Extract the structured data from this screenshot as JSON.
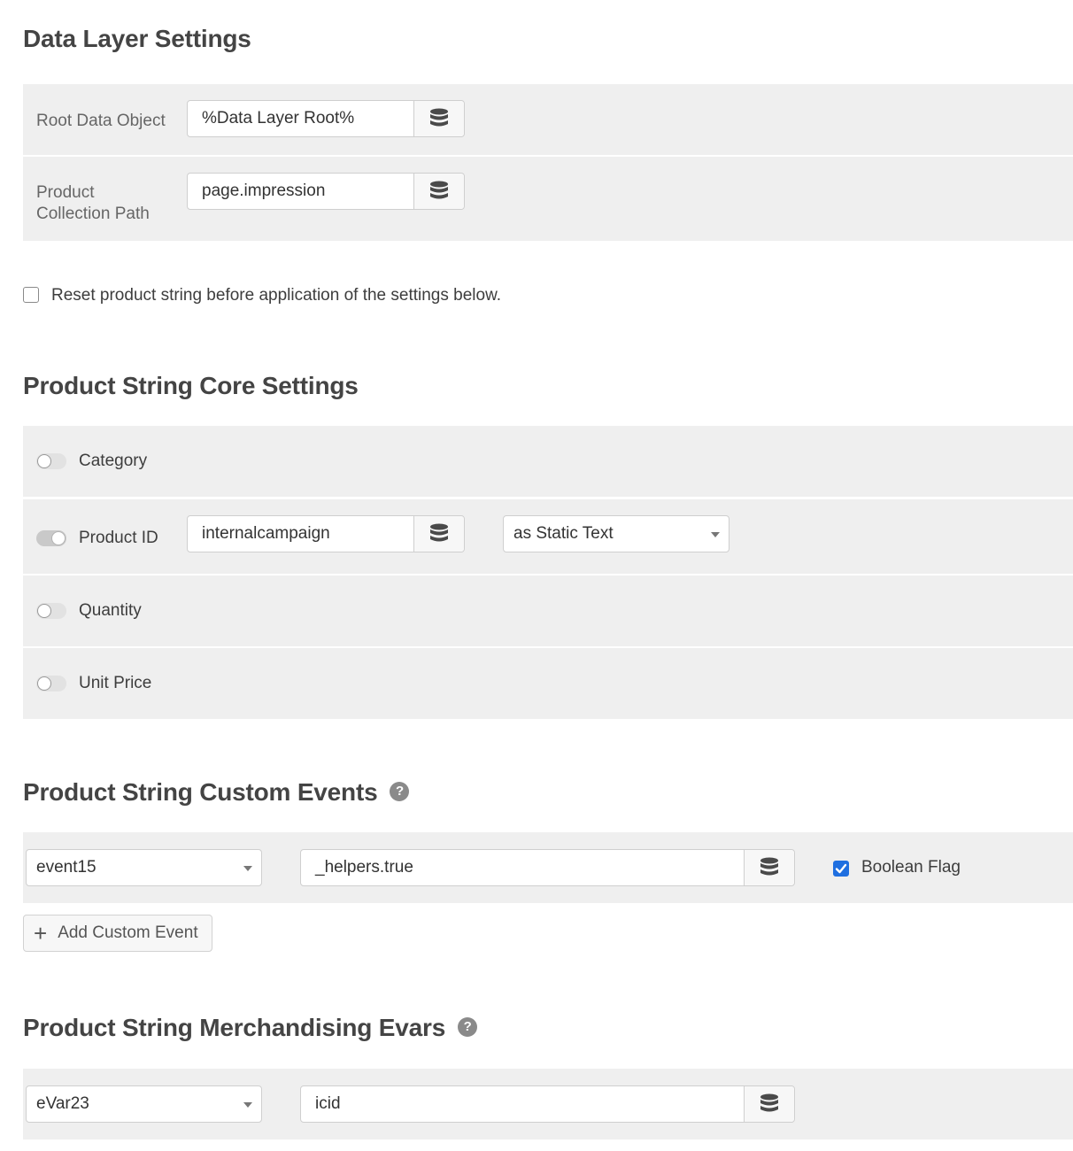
{
  "data_layer": {
    "title": "Data Layer Settings",
    "root_label": "Root Data Object",
    "root_value": "%Data Layer Root%",
    "collection_label_1": "Product",
    "collection_label_2": "Collection Path",
    "collection_value": "page.impression"
  },
  "reset_checkbox": {
    "label": "Reset product string before application of the settings below.",
    "checked": false
  },
  "core": {
    "title": "Product String Core Settings",
    "category_label": "Category",
    "product_id_label": "Product ID",
    "product_id_value": "internalcampaign",
    "product_id_mode": "as Static Text",
    "quantity_label": "Quantity",
    "unit_price_label": "Unit Price"
  },
  "custom_events": {
    "title": "Product String Custom Events",
    "help": "?",
    "event_select": "event15",
    "event_value": "_helpers.true",
    "boolean_label": "Boolean Flag",
    "boolean_checked": true,
    "add_label": "Add Custom Event"
  },
  "evars": {
    "title": "Product String Merchandising Evars",
    "help": "?",
    "evar_select": "eVar23",
    "evar_value": "icid"
  },
  "colors": {
    "row_bg": "#efefef",
    "checkbox_accent": "#1f6fe0"
  }
}
